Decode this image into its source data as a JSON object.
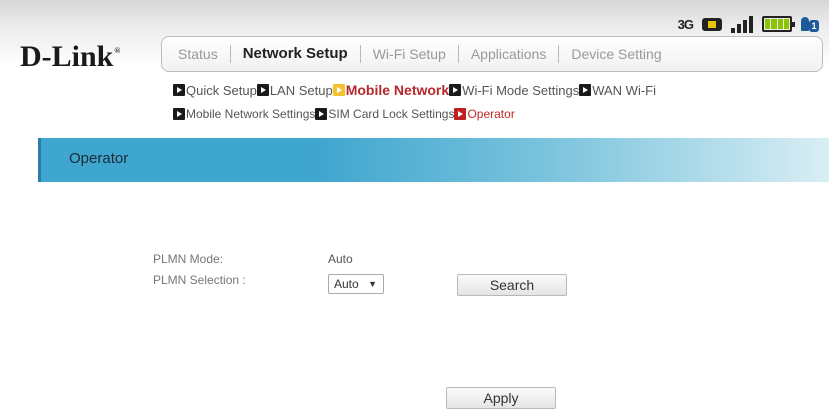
{
  "brand": {
    "name": "D-Link",
    "reg_mark": "®"
  },
  "status_bar": {
    "network_type": "3G",
    "icons": [
      "sms-icon",
      "signal-icon",
      "battery-icon",
      "connected-users-icon"
    ],
    "users_count": "1"
  },
  "nav": {
    "items": [
      {
        "label": "Status"
      },
      {
        "label": "Network Setup"
      },
      {
        "label": "Wi-Fi Setup"
      },
      {
        "label": "Applications"
      },
      {
        "label": "Device Setting"
      }
    ],
    "active": "Network Setup"
  },
  "subnav": {
    "row1": [
      {
        "label": "Quick Setup"
      },
      {
        "label": "LAN Setup"
      },
      {
        "label": "Mobile Network"
      },
      {
        "label": "Wi-Fi Mode Settings"
      },
      {
        "label": "WAN Wi-Fi"
      }
    ],
    "row2": [
      {
        "label": "Mobile Network Settings"
      },
      {
        "label": "SIM Card Lock Settings"
      },
      {
        "label": "Operator"
      }
    ]
  },
  "section": {
    "title": "Operator"
  },
  "form": {
    "plmn_mode_label": "PLMN Mode:",
    "plmn_mode_value": "Auto",
    "plmn_selection_label": "PLMN Selection :",
    "plmn_selection_value": "Auto",
    "search_label": "Search",
    "apply_label": "Apply"
  },
  "colors": {
    "accent_blue": "#3fa6cf",
    "active_red": "#c02828",
    "highlight_yellow": "#f2c230"
  }
}
